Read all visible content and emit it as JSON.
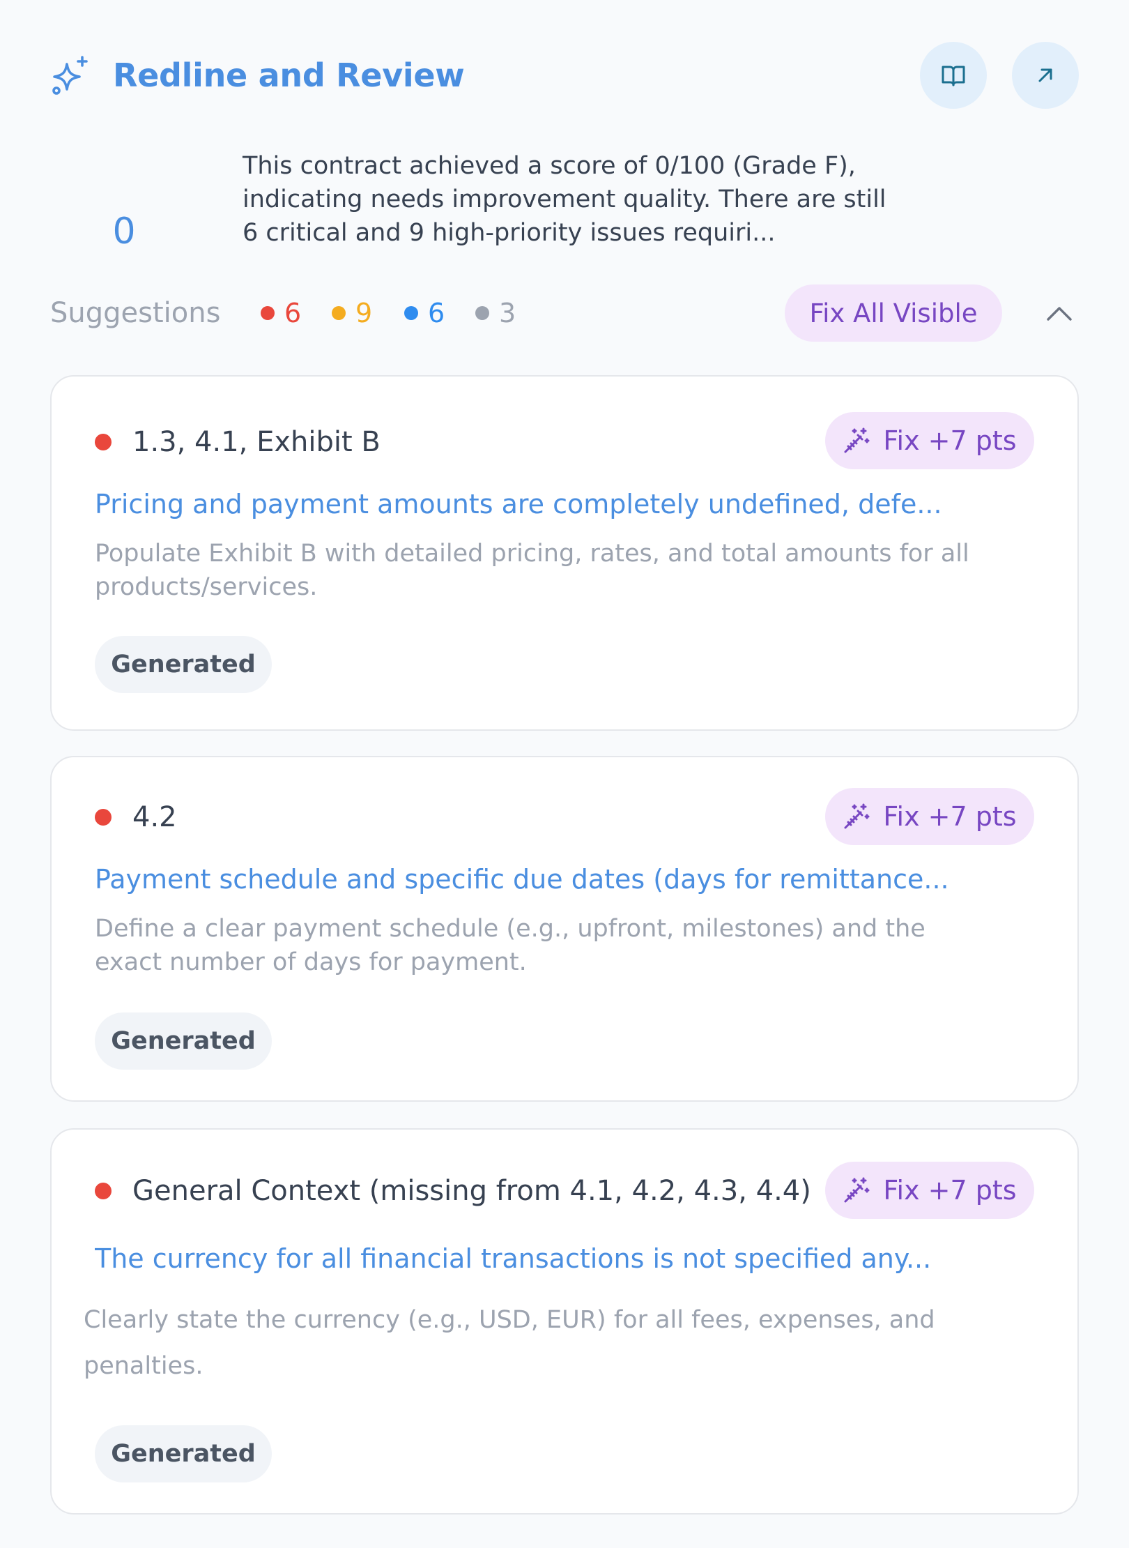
{
  "header": {
    "title": "Redline and Review",
    "icons": [
      "sparkle-icon",
      "book-icon",
      "expand-arrow-icon"
    ]
  },
  "score": {
    "value": "0",
    "summary": "This contract achieved a score of 0/100 (Grade F), indicating needs improvement quality. There are still 6 critical and 9 high-priority issues requiri..."
  },
  "suggestions": {
    "label": "Suggestions",
    "counts": {
      "critical": "6",
      "high": "9",
      "medium": "6",
      "low": "3"
    },
    "fix_all_label": "Fix All Visible"
  },
  "colors": {
    "accent": "#4a8ee0",
    "critical": "#e9473c",
    "high": "#f4ac20",
    "medium": "#2f8cef",
    "low": "#9ca3af",
    "fix_purple": "#7746c2",
    "fix_bg": "#f3e5fb"
  },
  "cards": [
    {
      "ref": "1.3, 4.1, Exhibit B",
      "fix_label": "Fix +7 pts",
      "issue": "Pricing and payment amounts are completely undefined, defe...",
      "detail": "Populate Exhibit B with detailed pricing, rates, and total amounts for all products/services.",
      "tag": "Generated"
    },
    {
      "ref": "4.2",
      "fix_label": "Fix +7 pts",
      "issue": "Payment schedule and specific due dates (days for remittance...",
      "detail": "Define a clear payment schedule (e.g., upfront, milestones) and the exact number of days for payment.",
      "tag": "Generated"
    },
    {
      "ref": "General Context (missing from 4.1, 4.2, 4.3, 4.4)",
      "fix_label": "Fix +7 pts",
      "issue": "The currency for all financial transactions is not specified any...",
      "detail": "Clearly state the currency (e.g., USD, EUR) for all fees, expenses, and penalties.",
      "tag": "Generated"
    }
  ]
}
